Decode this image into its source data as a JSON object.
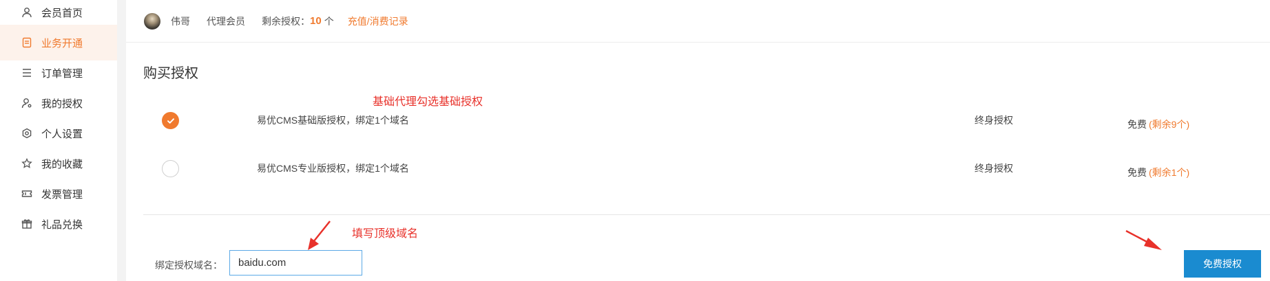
{
  "sidebar": {
    "items": [
      {
        "label": "会员首页",
        "icon": "user-icon",
        "active": false
      },
      {
        "label": "业务开通",
        "icon": "document-icon",
        "active": true
      },
      {
        "label": "订单管理",
        "icon": "list-icon",
        "active": false
      },
      {
        "label": "我的授权",
        "icon": "user-key-icon",
        "active": false
      },
      {
        "label": "个人设置",
        "icon": "settings-hex-icon",
        "active": false
      },
      {
        "label": "我的收藏",
        "icon": "star-icon",
        "active": false
      },
      {
        "label": "发票管理",
        "icon": "ticket-icon",
        "active": false
      },
      {
        "label": "礼品兑换",
        "icon": "gift-icon",
        "active": false
      }
    ]
  },
  "topbar": {
    "username": "伟哥",
    "role": "代理会员",
    "remaining_label": "剩余授权：",
    "remaining_count": "10",
    "remaining_unit": "个",
    "records_link": "充值/消费记录"
  },
  "section": {
    "title": "购买授权"
  },
  "annotations": {
    "select_hint": "基础代理勾选基础授权",
    "domain_hint": "填写顶级域名"
  },
  "licenses": [
    {
      "name": "易优CMS基础版授权，绑定1个域名",
      "term": "终身授权",
      "price": "免费",
      "remaining": "(剩余9个)",
      "checked": true
    },
    {
      "name": "易优CMS专业版授权，绑定1个域名",
      "term": "终身授权",
      "price": "免费",
      "remaining": "(剩余1个)",
      "checked": false
    }
  ],
  "form": {
    "domain_label": "绑定授权域名：",
    "domain_value": "baidu.com",
    "submit_label": "免费授权"
  },
  "colors": {
    "accent": "#f07a2e",
    "primary_button": "#1a8bd0",
    "annotation": "#e8312a"
  }
}
